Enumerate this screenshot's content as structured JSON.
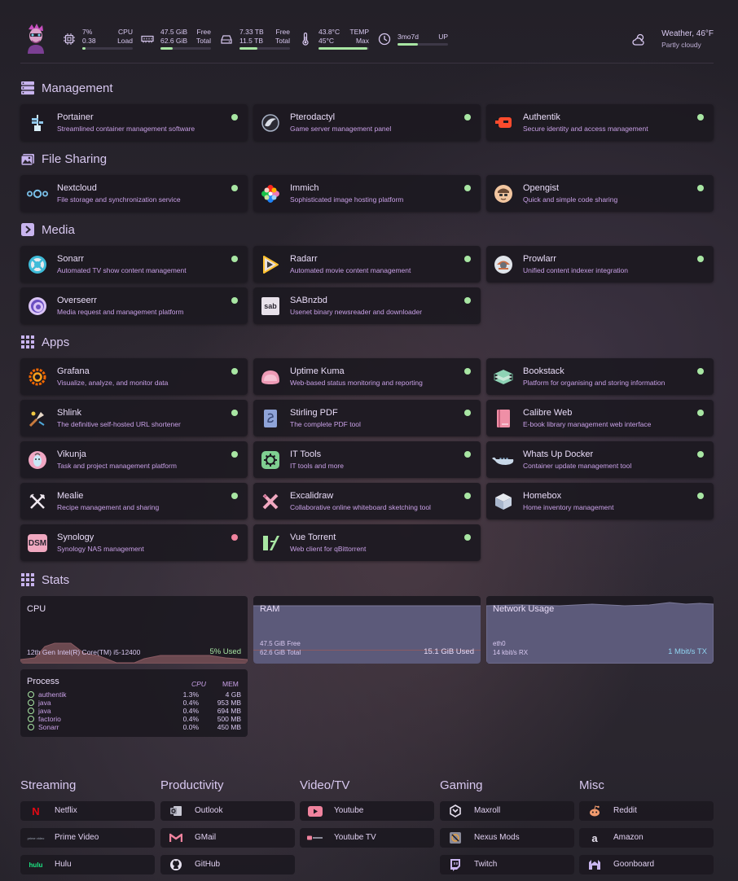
{
  "header": {
    "cpu": {
      "pct": "7%",
      "label": "CPU",
      "load": "0.38",
      "load_label": "Load",
      "fill": 0.07
    },
    "ram": {
      "free": "47.5 GiB",
      "free_label": "Free",
      "total": "62.6 GiB",
      "total_label": "Total",
      "fill": 0.24
    },
    "disk": {
      "free": "7.33 TB",
      "free_label": "Free",
      "total": "11.5 TB",
      "total_label": "Total",
      "fill": 0.36
    },
    "temp": {
      "val": "43.8°C",
      "label": "TEMP",
      "max": "45°C",
      "max_label": "Max",
      "fill": 0.97
    },
    "uptime": {
      "val": "3mo7d",
      "label": "UP",
      "fill": 0.4
    },
    "weather": {
      "title": "Weather, 46°F",
      "sub": "Partly cloudy"
    }
  },
  "sections": {
    "management": "Management",
    "file_sharing": "File Sharing",
    "media": "Media",
    "apps": "Apps",
    "stats": "Stats"
  },
  "services": {
    "portainer": {
      "name": "Portainer",
      "desc": "Streamlined container management software",
      "status": "up"
    },
    "pterodactyl": {
      "name": "Pterodactyl",
      "desc": "Game server management panel",
      "status": "up"
    },
    "authentik": {
      "name": "Authentik",
      "desc": "Secure identity and access management",
      "status": "up"
    },
    "nextcloud": {
      "name": "Nextcloud",
      "desc": "File storage and synchronization service",
      "status": "up"
    },
    "immich": {
      "name": "Immich",
      "desc": "Sophisticated image hosting platform",
      "status": "up"
    },
    "opengist": {
      "name": "Opengist",
      "desc": "Quick and simple code sharing",
      "status": "up"
    },
    "sonarr": {
      "name": "Sonarr",
      "desc": "Automated TV show content management",
      "status": "up"
    },
    "radarr": {
      "name": "Radarr",
      "desc": "Automated movie content management",
      "status": "up"
    },
    "prowlarr": {
      "name": "Prowlarr",
      "desc": "Unified content indexer integration",
      "status": "up"
    },
    "overseerr": {
      "name": "Overseerr",
      "desc": "Media request and management platform",
      "status": "up"
    },
    "sabnzbd": {
      "name": "SABnzbd",
      "desc": "Usenet binary newsreader and downloader",
      "status": "up"
    },
    "grafana": {
      "name": "Grafana",
      "desc": "Visualize, analyze, and monitor data",
      "status": "up"
    },
    "uptimekuma": {
      "name": "Uptime Kuma",
      "desc": "Web-based status monitoring and reporting",
      "status": "up"
    },
    "bookstack": {
      "name": "Bookstack",
      "desc": "Platform for organising and storing information",
      "status": "up"
    },
    "shlink": {
      "name": "Shlink",
      "desc": "The definitive self-hosted URL shortener",
      "status": "up"
    },
    "stirling": {
      "name": "Stirling PDF",
      "desc": "The complete PDF tool",
      "status": "up"
    },
    "calibre": {
      "name": "Calibre Web",
      "desc": "E-book library management web interface",
      "status": "up"
    },
    "vikunja": {
      "name": "Vikunja",
      "desc": "Task and project management platform",
      "status": "up"
    },
    "ittools": {
      "name": "IT Tools",
      "desc": "IT tools and more",
      "status": "up"
    },
    "wud": {
      "name": "Whats Up Docker",
      "desc": "Container update management tool",
      "status": "up"
    },
    "mealie": {
      "name": "Mealie",
      "desc": "Recipe management and sharing",
      "status": "up"
    },
    "excalidraw": {
      "name": "Excalidraw",
      "desc": "Collaborative online whiteboard sketching tool",
      "status": "up"
    },
    "homebox": {
      "name": "Homebox",
      "desc": "Home inventory management",
      "status": "up"
    },
    "synology": {
      "name": "Synology",
      "desc": "Synology NAS management",
      "status": "down"
    },
    "vuetorrent": {
      "name": "Vue Torrent",
      "desc": "Web client for qBittorrent",
      "status": "up"
    }
  },
  "icon_text": {
    "sabnzbd": "sab",
    "synology": "DSM",
    "netflix": "N",
    "prime": "prime video",
    "hulu": "hulu",
    "amazon": "a"
  },
  "stats": {
    "cpu": {
      "title": "CPU",
      "model": "12th Gen Intel(R) Core(TM) i5-12400",
      "used": "5% Used"
    },
    "ram": {
      "title": "RAM",
      "free": "47.5 GiB Free",
      "total": "62.6 GiB Total",
      "used": "15.1 GiB Used"
    },
    "net": {
      "title": "Network Usage",
      "iface": "eth0",
      "rx": "14 kbit/s RX",
      "tx": "1 Mbit/s TX"
    }
  },
  "process": {
    "title": "Process",
    "cpu_label": "CPU",
    "mem_label": "MEM",
    "rows": [
      {
        "name": "authentik",
        "cpu": "1.3%",
        "mem": "4 GB"
      },
      {
        "name": "java",
        "cpu": "0.4%",
        "mem": "953 MB"
      },
      {
        "name": "java",
        "cpu": "0.4%",
        "mem": "694 MB"
      },
      {
        "name": "factorio",
        "cpu": "0.4%",
        "mem": "500 MB"
      },
      {
        "name": "Sonarr",
        "cpu": "0.0%",
        "mem": "450 MB"
      }
    ]
  },
  "bookmarks": {
    "streaming": {
      "title": "Streaming",
      "items": [
        "Netflix",
        "Prime Video",
        "Hulu"
      ]
    },
    "productivity": {
      "title": "Productivity",
      "items": [
        "Outlook",
        "GMail",
        "GitHub"
      ]
    },
    "videotv": {
      "title": "Video/TV",
      "items": [
        "Youtube",
        "Youtube TV"
      ]
    },
    "gaming": {
      "title": "Gaming",
      "items": [
        "Maxroll",
        "Nexus Mods",
        "Twitch"
      ]
    },
    "misc": {
      "title": "Misc",
      "items": [
        "Reddit",
        "Amazon",
        "Goonboard"
      ]
    }
  },
  "colors": {
    "status_up": "#a8e6a3",
    "status_down": "#f0839e",
    "accent": "#c8a0e6"
  }
}
